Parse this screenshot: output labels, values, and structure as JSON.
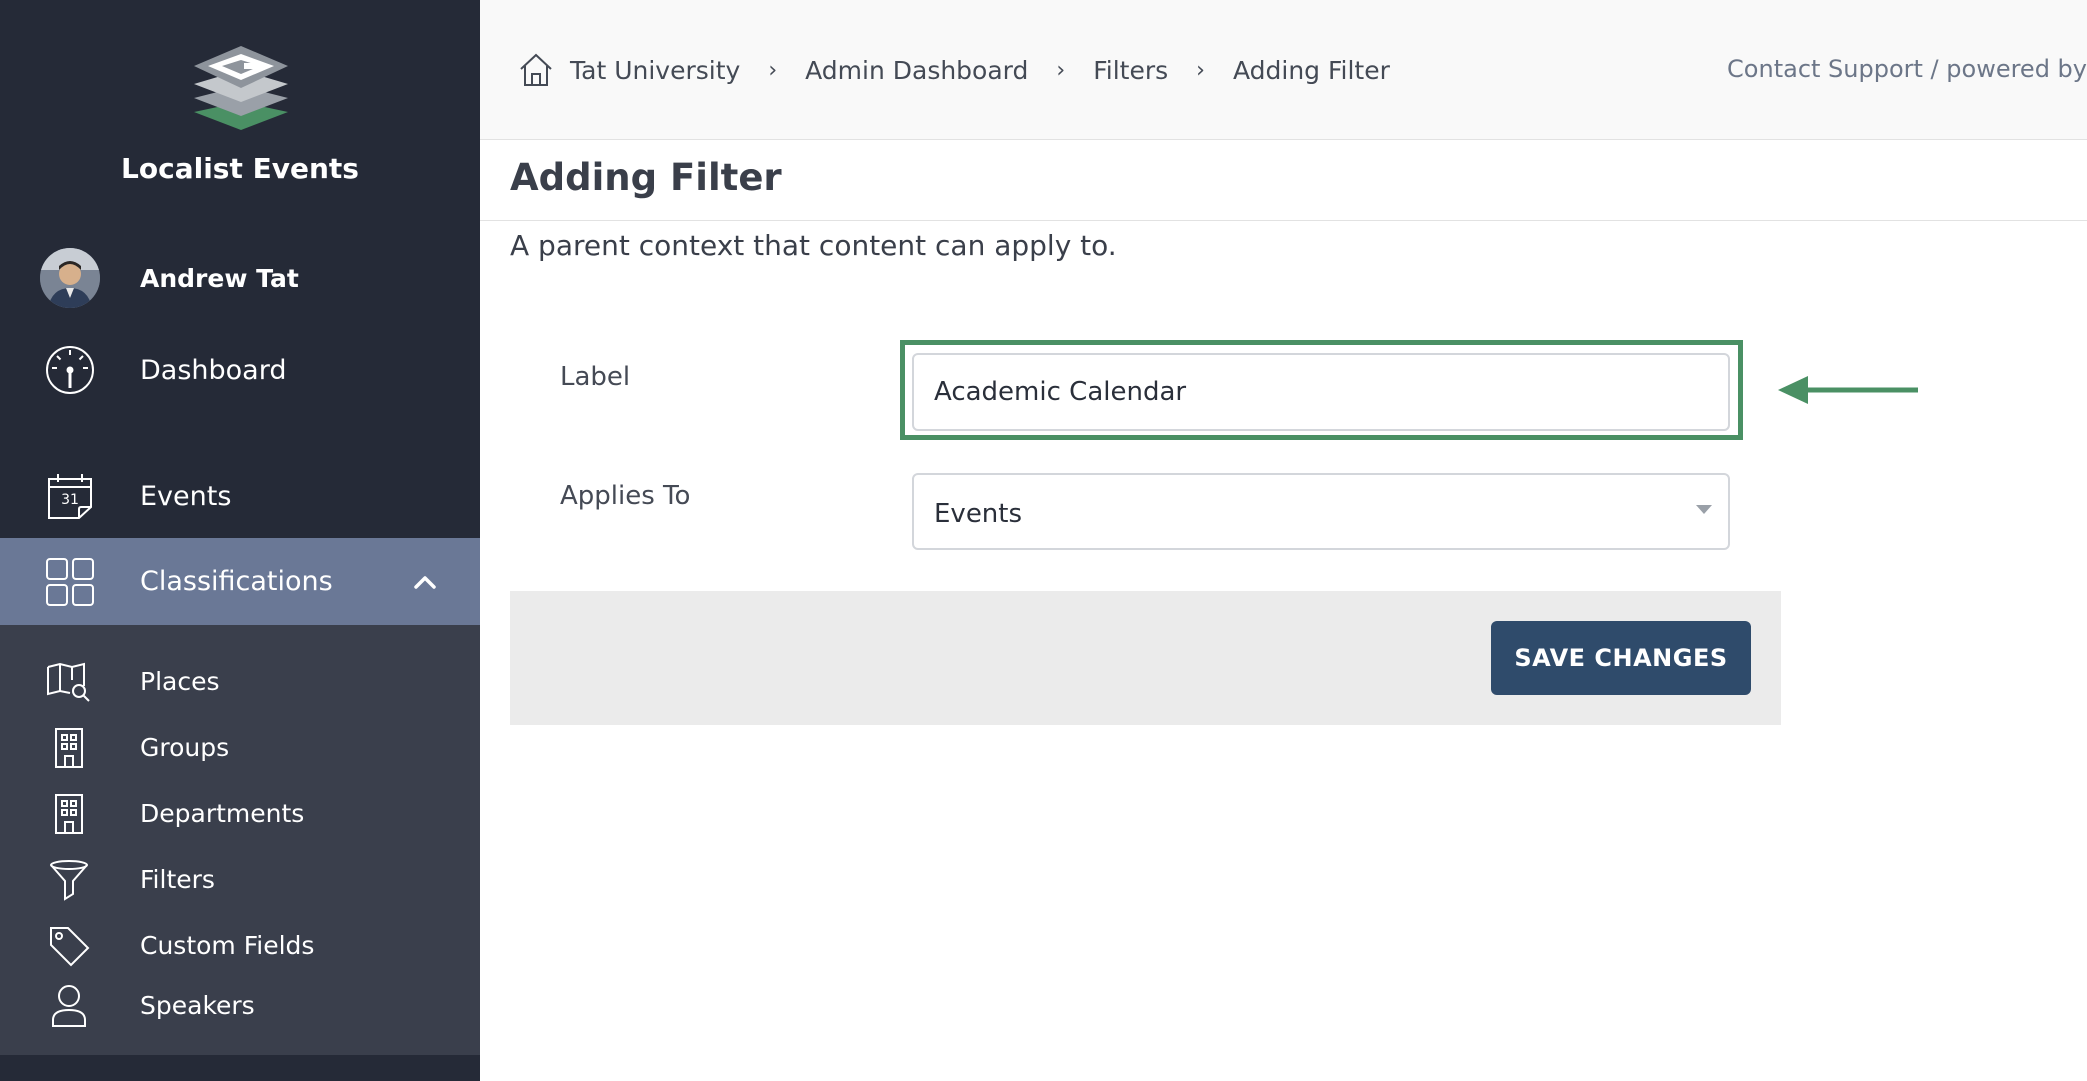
{
  "app": {
    "title": "Localist Events"
  },
  "sidebar": {
    "user_name": "Andrew Tat",
    "items": [
      {
        "label": "Dashboard",
        "icon": "gauge-icon"
      },
      {
        "label": "Events",
        "icon": "calendar-icon",
        "calendar_day": "31"
      },
      {
        "label": "Classifications",
        "icon": "grid-icon",
        "expanded": true
      }
    ],
    "subitems": [
      {
        "label": "Places",
        "icon": "map-search-icon"
      },
      {
        "label": "Groups",
        "icon": "building-icon"
      },
      {
        "label": "Departments",
        "icon": "building-icon"
      },
      {
        "label": "Filters",
        "icon": "funnel-icon"
      },
      {
        "label": "Custom Fields",
        "icon": "tag-icon"
      },
      {
        "label": "Speakers",
        "icon": "person-icon"
      }
    ]
  },
  "breadcrumb": [
    "Tat University",
    "Admin Dashboard",
    "Filters",
    "Adding Filter"
  ],
  "breadcrumb_separator": "›",
  "support_text": "Contact Support / powered by",
  "page": {
    "title": "Adding Filter",
    "description": "A parent context that content can apply to."
  },
  "form": {
    "label_field": {
      "label": "Label",
      "value": "Academic Calendar"
    },
    "applies_to_field": {
      "label": "Applies To",
      "value": "Events"
    },
    "save_label": "SAVE CHANGES"
  },
  "colors": {
    "sidebar_bg": "#252a37",
    "submenu_bg": "#3a3f4c",
    "active_item_bg": "#6a7896",
    "highlight_green": "#4a9064",
    "save_button_bg": "#2f4b6b"
  }
}
